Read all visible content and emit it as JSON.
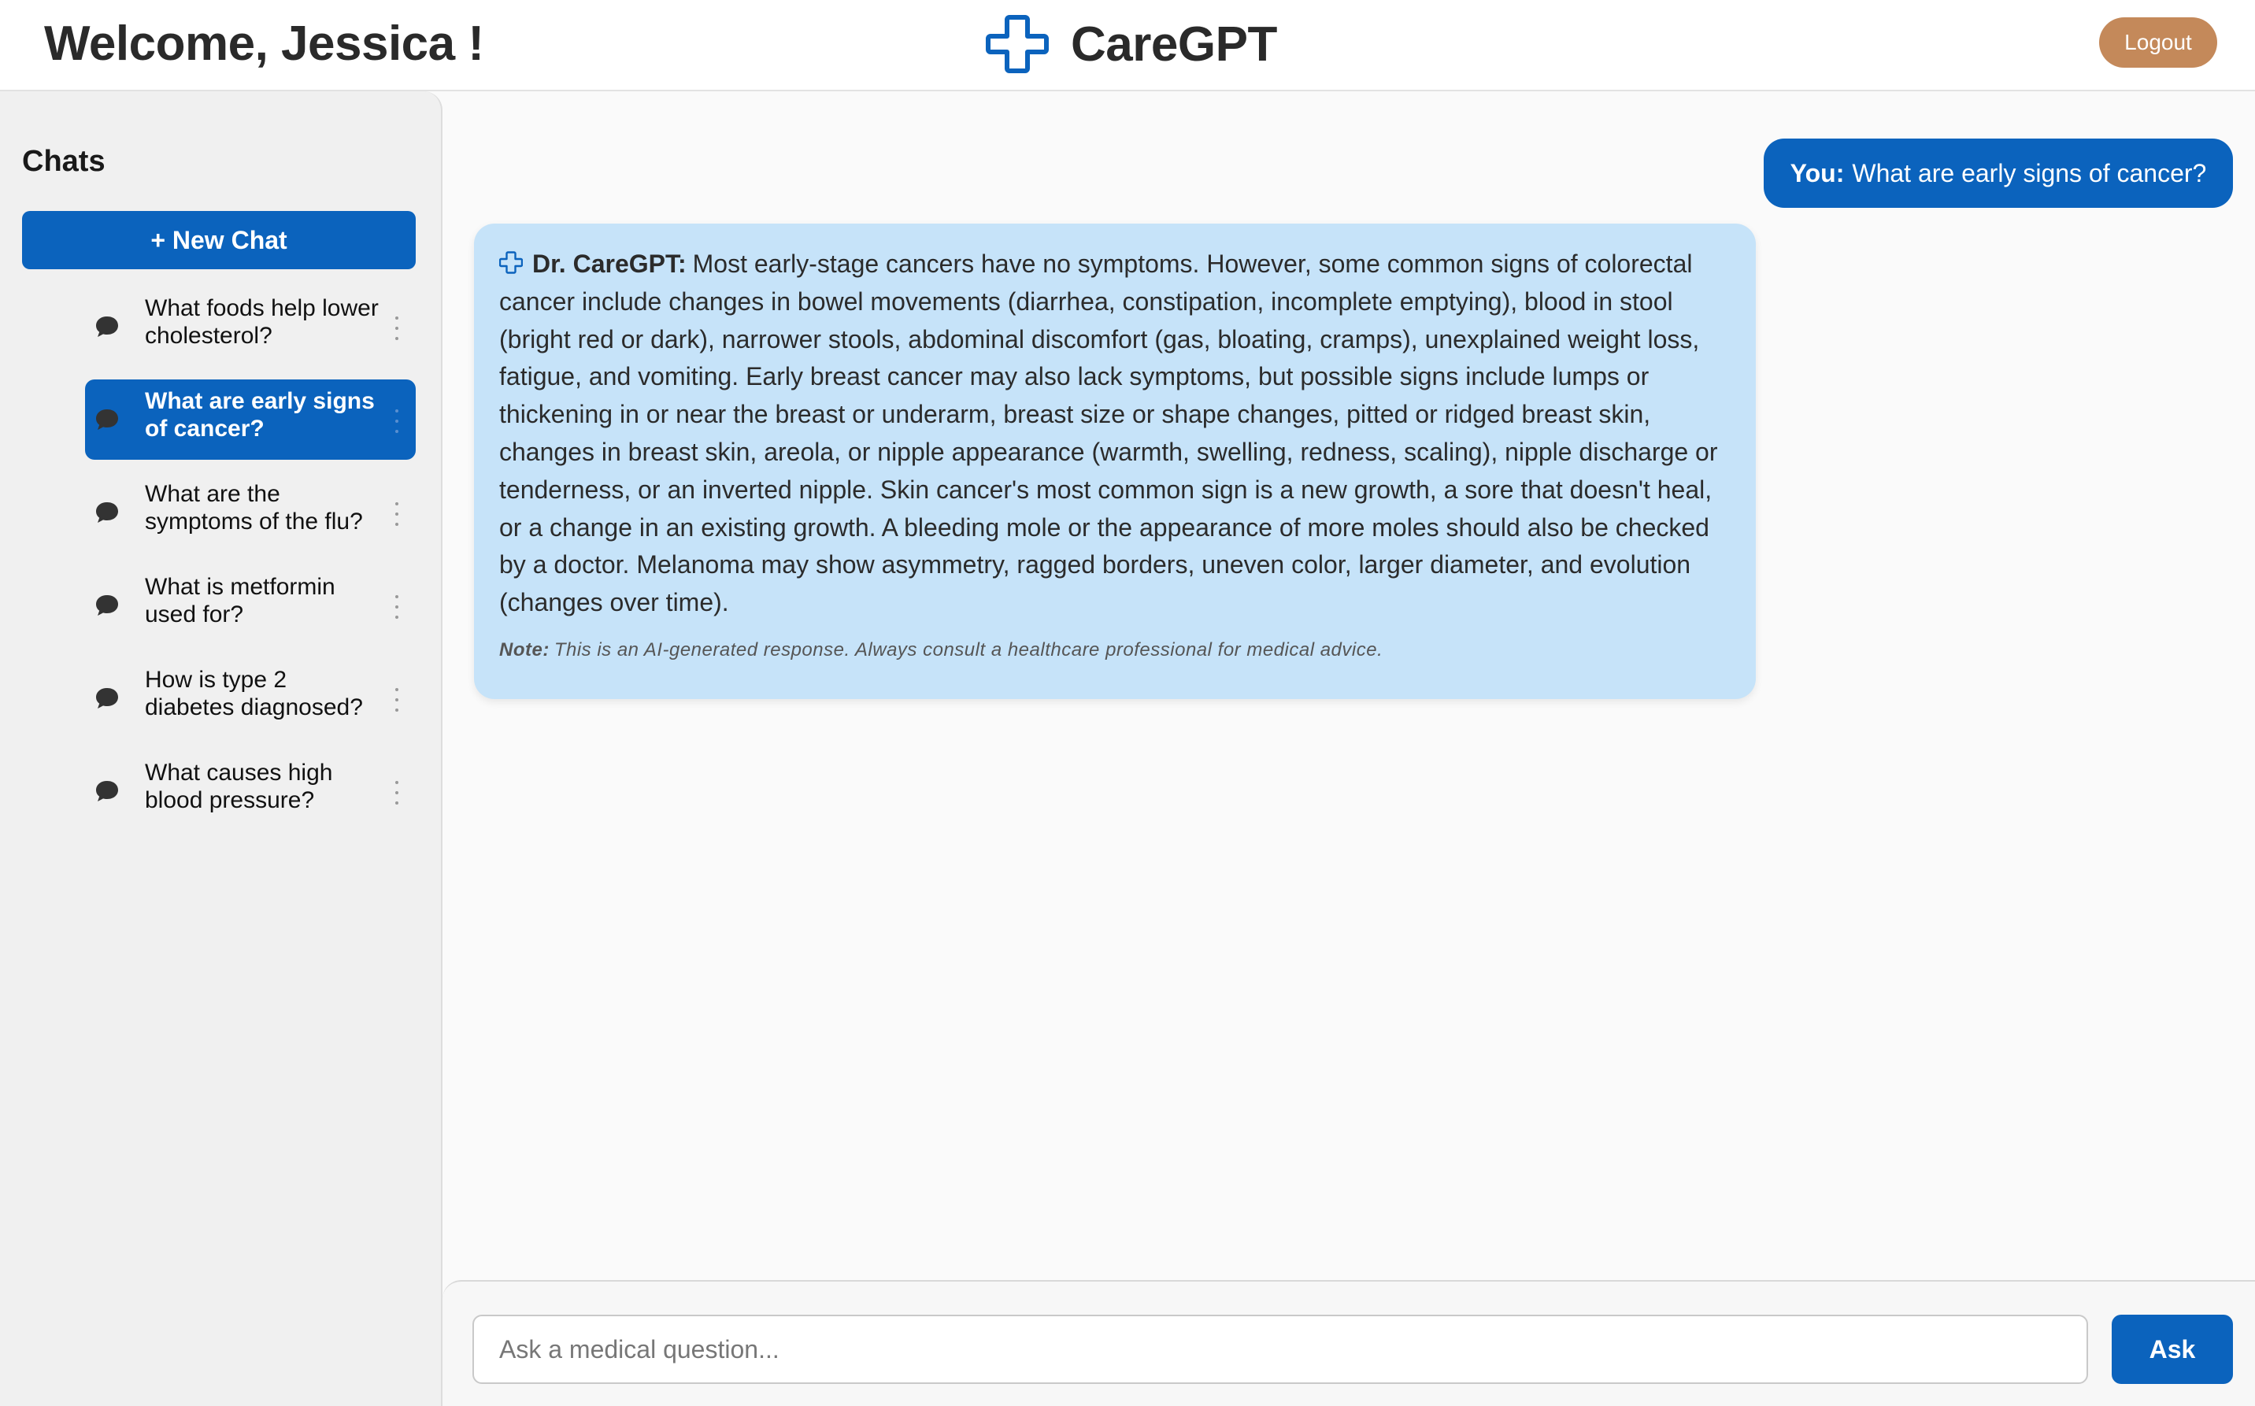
{
  "header": {
    "welcome": "Welcome, Jessica !",
    "brand_name": "CareGPT",
    "logo_icon": "medical-cross-icon",
    "logout_label": "Logout",
    "logout_color": "#c4895a"
  },
  "sidebar": {
    "title": "Chats",
    "new_chat_label": "+ New Chat",
    "items": [
      {
        "label": "What foods help lower cholesterol?",
        "active": false,
        "icon": "chat-bubble-icon"
      },
      {
        "label": "What are early signs of cancer?",
        "active": true,
        "icon": "chat-bubble-icon"
      },
      {
        "label": "What are the symptoms of the flu?",
        "active": false,
        "icon": "chat-bubble-icon"
      },
      {
        "label": "What is metformin used for?",
        "active": false,
        "icon": "chat-bubble-icon"
      },
      {
        "label": "How is type 2 diabetes diagnosed?",
        "active": false,
        "icon": "chat-bubble-icon"
      },
      {
        "label": "What causes high blood pressure?",
        "active": false,
        "icon": "chat-bubble-icon"
      }
    ]
  },
  "conversation": {
    "user_prefix": "You:",
    "user_message": "What are early signs of cancer?",
    "bot_prefix": "Dr. CareGPT:",
    "bot_message": "Most early-stage cancers have no symptoms. However, some common signs of colorectal cancer include changes in bowel movements (diarrhea, constipation, incomplete emptying), blood in stool (bright red or dark), narrower stools, abdominal discomfort (gas, bloating, cramps), unexplained weight loss, fatigue, and vomiting. Early breast cancer may also lack symptoms, but possible signs include lumps or thickening in or near the breast or underarm, breast size or shape changes, pitted or ridged breast skin, changes in breast skin, areola, or nipple appearance (warmth, swelling, redness, scaling), nipple discharge or tenderness, or an inverted nipple. Skin cancer's most common sign is a new growth, a sore that doesn't heal, or a change in an existing growth. A bleeding mole or the appearance of more moles should also be checked by a doctor. Melanoma may show asymmetry, ragged borders, uneven color, larger diameter, and evolution (changes over time).",
    "note_prefix": "Note:",
    "note_text": "This is an AI-generated response. Always consult a healthcare professional for medical advice."
  },
  "composer": {
    "placeholder": "Ask a medical question...",
    "value": "",
    "ask_label": "Ask"
  },
  "colors": {
    "primary": "#0b63bd",
    "bot_bubble": "#c6e3f9",
    "sidebar_bg": "#f0f0f0"
  }
}
